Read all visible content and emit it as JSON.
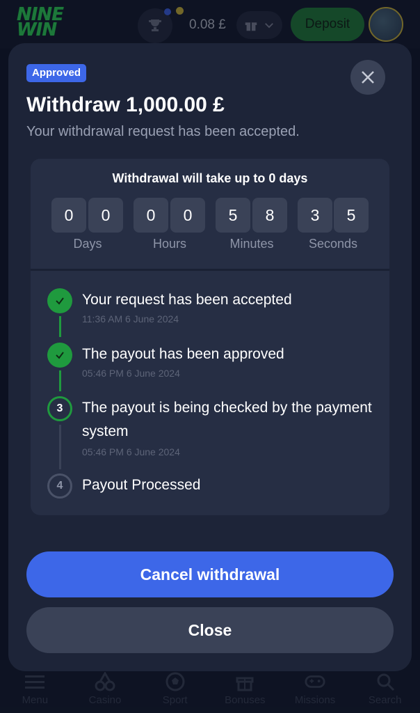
{
  "header": {
    "logo_line1": "NINE",
    "logo_line2": "WIN",
    "balance": "0.08 £",
    "deposit_label": "Deposit",
    "accent_green": "#1f7a3a"
  },
  "bottom_nav": {
    "items": [
      {
        "label": "Menu",
        "icon": "menu-icon"
      },
      {
        "label": "Casino",
        "icon": "cherries-icon"
      },
      {
        "label": "Sport",
        "icon": "soccer-ball-icon"
      },
      {
        "label": "Bonuses",
        "icon": "gift-icon"
      },
      {
        "label": "Missions",
        "icon": "gamepad-icon"
      },
      {
        "label": "Search",
        "icon": "search-icon"
      }
    ]
  },
  "modal": {
    "badge": "Approved",
    "title": "Withdraw 1,000.00 £",
    "subtitle": "Your withdrawal request has been accepted.",
    "timer": {
      "heading": "Withdrawal will take up to 0 days",
      "digits": [
        "0",
        "0",
        "0",
        "0",
        "5",
        "8",
        "3",
        "5"
      ],
      "units": [
        "Days",
        "Hours",
        "Minutes",
        "Seconds"
      ]
    },
    "steps": [
      {
        "label": "Your request has been accepted",
        "time": "11:36 AM 6 June 2024",
        "status": "done"
      },
      {
        "label": "The payout has been approved",
        "time": "05:46 PM 6 June 2024",
        "status": "done"
      },
      {
        "label": "The payout is being checked by the payment system",
        "time": "05:46 PM 6 June 2024",
        "status": "current",
        "number": "3"
      },
      {
        "label": "Payout Processed",
        "time": "",
        "status": "pending",
        "number": "4"
      }
    ],
    "cancel_label": "Cancel withdrawal",
    "close_label": "Close",
    "accent_blue": "#3d67e8"
  }
}
